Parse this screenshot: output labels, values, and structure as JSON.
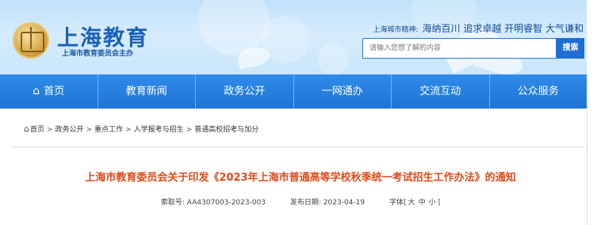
{
  "header": {
    "site_title": "上海教育",
    "site_subtitle": "上海市教育委员会主办",
    "spirit_label": "上海城市精神:",
    "spirit_text": "海纳百川 追求卓越 开明睿智 大气谦和"
  },
  "search": {
    "placeholder": "请输入您想了解的内容",
    "button_label": "搜索"
  },
  "nav": {
    "items": [
      {
        "label": "首页",
        "icon": "home-icon"
      },
      {
        "label": "教育新闻"
      },
      {
        "label": "政务公开"
      },
      {
        "label": "一网通办"
      },
      {
        "label": "交流互动"
      },
      {
        "label": "公众服务"
      }
    ]
  },
  "breadcrumb": {
    "icon": "home-icon",
    "items": [
      "首页",
      "政务公开",
      "重点工作",
      "入学报考与招生",
      "普通高校招考与加分"
    ],
    "separator": ">"
  },
  "article": {
    "title": "上海市教育委员会关于印发《2023年上海市普通高等学校秋季统一考试招生工作办法》的通知",
    "index_label": "索取号:",
    "index_value": "AA4307003-2023-003",
    "date_label": "发布日期:",
    "date_value": "2023-04-19",
    "font_label": "字体",
    "font_open": "[",
    "font_sizes": [
      "大",
      "中",
      "小"
    ],
    "font_close": "]"
  },
  "colors": {
    "nav_blue": "#1e74d4",
    "title_orange": "#e04a1b",
    "brand_blue": "#1b60b7"
  }
}
